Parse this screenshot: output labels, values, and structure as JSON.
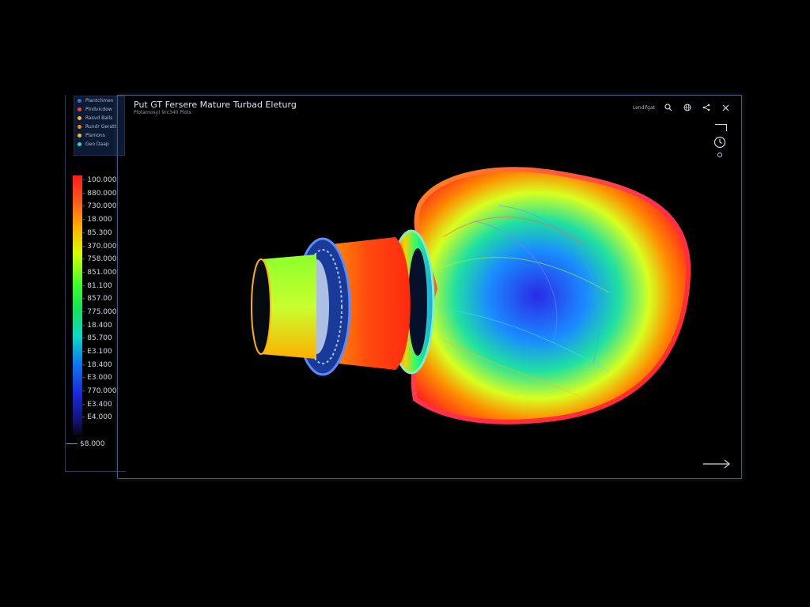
{
  "window": {
    "title": "Put GT Fersere Mature Turbad Eleturg",
    "subtitle": "Plotamosy) 9rc340 Plots"
  },
  "legend": {
    "items": [
      {
        "label": "Plantchmen",
        "color": "#3a6ee8"
      },
      {
        "label": "Plndvicdow",
        "color": "#e84848"
      },
      {
        "label": "Rasvd Balls",
        "color": "#f0c020"
      },
      {
        "label": "Rundr Geratt",
        "color": "#f08a20"
      },
      {
        "label": "Plsmons",
        "color": "#e8c030"
      },
      {
        "label": "Geo Daap",
        "color": "#20e0b0"
      }
    ]
  },
  "color_scale": {
    "ticks": [
      "100.000",
      "880.000",
      "730.000",
      "18.000",
      "85.300",
      "370.000",
      "758.000",
      "851.000",
      "81.100",
      "857.00",
      "775.000",
      "18.400",
      "85.700",
      "E3.100",
      "18.400",
      "E3.000",
      "770.000",
      "E3.400",
      "E4.000"
    ],
    "min_label": "$8.000"
  },
  "toolbar": {
    "label": "Lendifgat",
    "icons": [
      "search-icon",
      "globe-icon",
      "share-icon",
      "close-icon"
    ]
  }
}
